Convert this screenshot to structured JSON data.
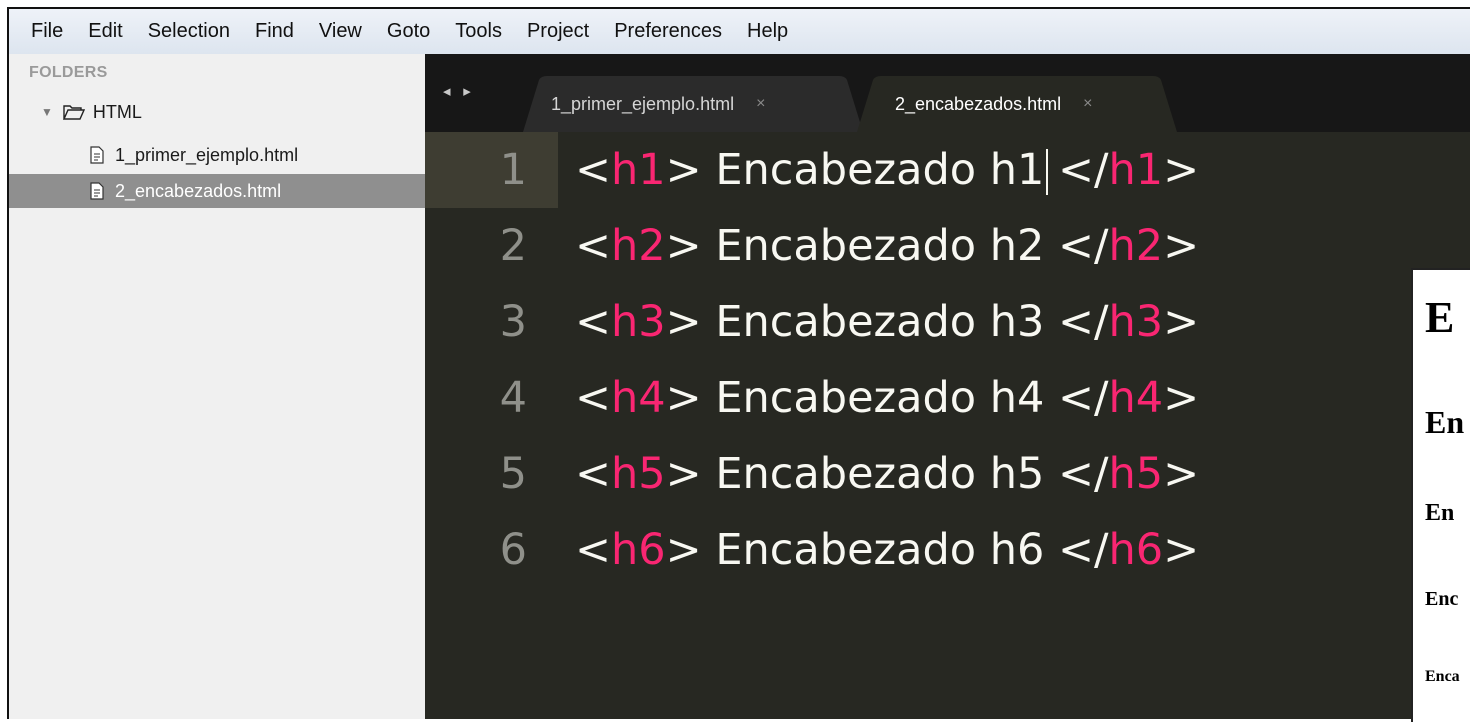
{
  "menu": [
    "File",
    "Edit",
    "Selection",
    "Find",
    "View",
    "Goto",
    "Tools",
    "Project",
    "Preferences",
    "Help"
  ],
  "sidebar": {
    "header": "FOLDERS",
    "folder": "HTML",
    "files": [
      "1_primer_ejemplo.html",
      "2_encabezados.html"
    ]
  },
  "tabs": {
    "nav": "◂ ▸",
    "items": [
      {
        "label": "1_primer_ejemplo.html",
        "close": "×"
      },
      {
        "label": "2_encabezados.html",
        "close": "×"
      }
    ]
  },
  "editor": {
    "lines": [
      {
        "num": "1",
        "tag": "h1",
        "text": "Encabezado h1"
      },
      {
        "num": "2",
        "tag": "h2",
        "text": "Encabezado h2"
      },
      {
        "num": "3",
        "tag": "h3",
        "text": "Encabezado h3"
      },
      {
        "num": "4",
        "tag": "h4",
        "text": "Encabezado h4"
      },
      {
        "num": "5",
        "tag": "h5",
        "text": "Encabezado h5"
      },
      {
        "num": "6",
        "tag": "h6",
        "text": "Encabezado h6"
      }
    ]
  },
  "preview": {
    "headings": [
      "E",
      "En",
      "En",
      "Enc",
      "Enca"
    ]
  },
  "colors": {
    "tag": "#f92672",
    "text": "#f8f8f2",
    "background": "#272822",
    "line_number": "#8f908a"
  }
}
